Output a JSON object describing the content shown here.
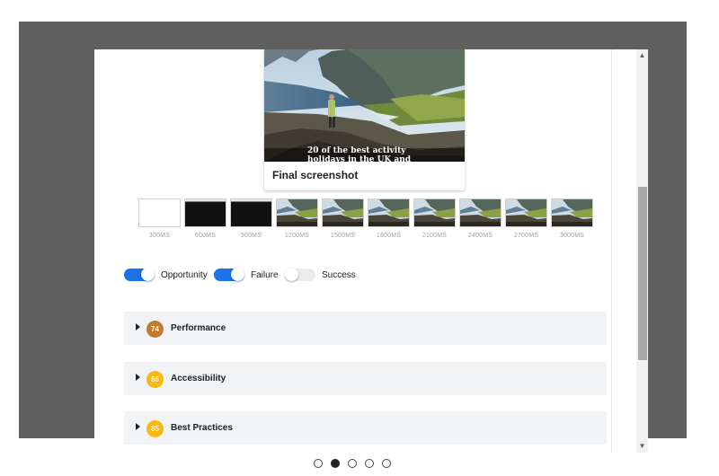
{
  "final_screenshot": {
    "label": "Final screenshot",
    "overlay_text": "20 of the best activity holidays in the UK and"
  },
  "filmstrip": [
    {
      "time": "300MS",
      "state": "blank"
    },
    {
      "time": "600MS",
      "state": "dark"
    },
    {
      "time": "900MS",
      "state": "dark"
    },
    {
      "time": "1200MS",
      "state": "loaded"
    },
    {
      "time": "1500MS",
      "state": "loaded"
    },
    {
      "time": "1800MS",
      "state": "loaded"
    },
    {
      "time": "2100MS",
      "state": "loaded"
    },
    {
      "time": "2400MS",
      "state": "loaded"
    },
    {
      "time": "2700MS",
      "state": "loaded"
    },
    {
      "time": "3000MS",
      "state": "loaded"
    }
  ],
  "toggles": [
    {
      "label": "Opportunity",
      "on": true
    },
    {
      "label": "Failure",
      "on": true
    },
    {
      "label": "Success",
      "on": false
    }
  ],
  "categories": [
    {
      "score": "74",
      "name": "Performance",
      "color": "#c07b2e"
    },
    {
      "score": "86",
      "name": "Accessibility",
      "color": "#f9b80f"
    },
    {
      "score": "85",
      "name": "Best Practices",
      "color": "#f9b80f"
    }
  ],
  "carousel": {
    "total": 5,
    "active_index": 1
  },
  "colors": {
    "toggle_on": "#1a73e8",
    "toggle_off": "#dadce0",
    "panel_bg": "#f1f3f4"
  }
}
